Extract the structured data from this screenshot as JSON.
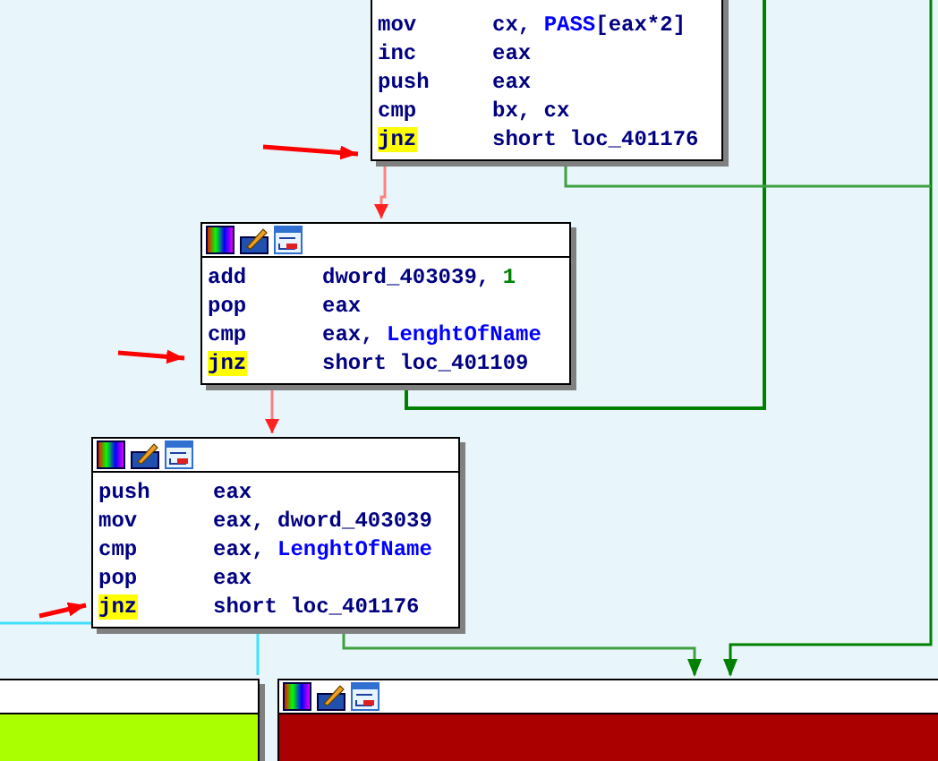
{
  "blocks": [
    {
      "toolbar": false,
      "rows": [
        {
          "mnemonic": "mov",
          "highlighted": false,
          "operands": [
            {
              "text": "cx, ",
              "kind": "plain"
            },
            {
              "text": "PASS",
              "kind": "name"
            },
            {
              "text": "[eax*2]",
              "kind": "plain"
            }
          ]
        },
        {
          "mnemonic": "inc",
          "highlighted": false,
          "operands": [
            {
              "text": "eax",
              "kind": "plain"
            }
          ]
        },
        {
          "mnemonic": "push",
          "highlighted": false,
          "operands": [
            {
              "text": "eax",
              "kind": "plain"
            }
          ]
        },
        {
          "mnemonic": "cmp",
          "highlighted": false,
          "operands": [
            {
              "text": "bx, cx",
              "kind": "plain"
            }
          ]
        },
        {
          "mnemonic": "jnz",
          "highlighted": true,
          "operands": [
            {
              "text": "short loc_401176",
              "kind": "plain"
            }
          ]
        }
      ]
    },
    {
      "toolbar": true,
      "rows": [
        {
          "mnemonic": "add",
          "highlighted": false,
          "operands": [
            {
              "text": "dword_403039, ",
              "kind": "plain"
            },
            {
              "text": "1",
              "kind": "number"
            }
          ]
        },
        {
          "mnemonic": "pop",
          "highlighted": false,
          "operands": [
            {
              "text": "eax",
              "kind": "plain"
            }
          ]
        },
        {
          "mnemonic": "cmp",
          "highlighted": false,
          "operands": [
            {
              "text": "eax, ",
              "kind": "plain"
            },
            {
              "text": "LenghtOfName",
              "kind": "name"
            }
          ]
        },
        {
          "mnemonic": "jnz",
          "highlighted": true,
          "operands": [
            {
              "text": "short loc_401109",
              "kind": "plain"
            }
          ]
        }
      ]
    },
    {
      "toolbar": true,
      "rows": [
        {
          "mnemonic": "push",
          "highlighted": false,
          "operands": [
            {
              "text": "eax",
              "kind": "plain"
            }
          ]
        },
        {
          "mnemonic": "mov",
          "highlighted": false,
          "operands": [
            {
              "text": "eax, dword_403039",
              "kind": "plain"
            }
          ]
        },
        {
          "mnemonic": "cmp",
          "highlighted": false,
          "operands": [
            {
              "text": "eax, ",
              "kind": "plain"
            },
            {
              "text": "LenghtOfName",
              "kind": "name"
            }
          ]
        },
        {
          "mnemonic": "pop",
          "highlighted": false,
          "operands": [
            {
              "text": "eax",
              "kind": "plain"
            }
          ]
        },
        {
          "mnemonic": "jnz",
          "highlighted": true,
          "operands": [
            {
              "text": "short loc_401176",
              "kind": "plain"
            }
          ]
        }
      ]
    },
    {
      "toolbar": false,
      "color": "#aaff00"
    },
    {
      "toolbar": true,
      "color": "#aa0000"
    }
  ]
}
